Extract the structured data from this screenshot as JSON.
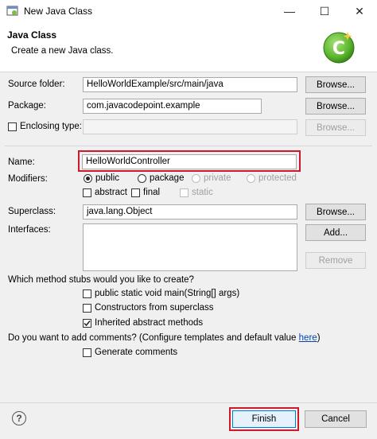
{
  "window": {
    "title": "New Java Class",
    "minimize_glyph": "—",
    "maximize_glyph": "☐",
    "close_glyph": "✕"
  },
  "header": {
    "title": "Java Class",
    "subtitle": "Create a new Java class."
  },
  "form": {
    "source_folder": {
      "label": "Source folder:",
      "value": "HelloWorldExample/src/main/java",
      "button": "Browse..."
    },
    "package": {
      "label": "Package:",
      "value": "com.javacodepoint.example",
      "button": "Browse..."
    },
    "enclosing_type": {
      "label": "Enclosing type:",
      "checked": false,
      "value": "",
      "button": "Browse..."
    },
    "name": {
      "label": "Name:",
      "value": "HelloWorldController"
    },
    "modifiers": {
      "label": "Modifiers:",
      "access": [
        {
          "label": "public",
          "selected": true,
          "enabled": true
        },
        {
          "label": "package",
          "selected": false,
          "enabled": true
        },
        {
          "label": "private",
          "selected": false,
          "enabled": false
        },
        {
          "label": "protected",
          "selected": false,
          "enabled": false
        }
      ],
      "abstract": {
        "label": "abstract",
        "checked": false
      },
      "final": {
        "label": "final",
        "checked": false
      },
      "static": {
        "label": "static",
        "checked": false,
        "enabled": false
      }
    },
    "superclass": {
      "label": "Superclass:",
      "value": "java.lang.Object",
      "button": "Browse..."
    },
    "interfaces": {
      "label": "Interfaces:",
      "add_button": "Add...",
      "remove_button": "Remove"
    }
  },
  "stubs": {
    "question": "Which method stubs would you like to create?",
    "options": [
      {
        "label": "public static void main(String[] args)",
        "checked": false
      },
      {
        "label": "Constructors from superclass",
        "checked": false
      },
      {
        "label": "Inherited abstract methods",
        "checked": true
      }
    ]
  },
  "comments": {
    "question": "Do you want to add comments? (Configure templates and default value ",
    "link": "here",
    "close_paren": ")",
    "option": {
      "label": "Generate comments",
      "checked": false
    }
  },
  "footer": {
    "help_glyph": "?",
    "finish": "Finish",
    "cancel": "Cancel"
  },
  "colors": {
    "highlight": "#d0182b",
    "logo_green": "#5cb82e"
  }
}
